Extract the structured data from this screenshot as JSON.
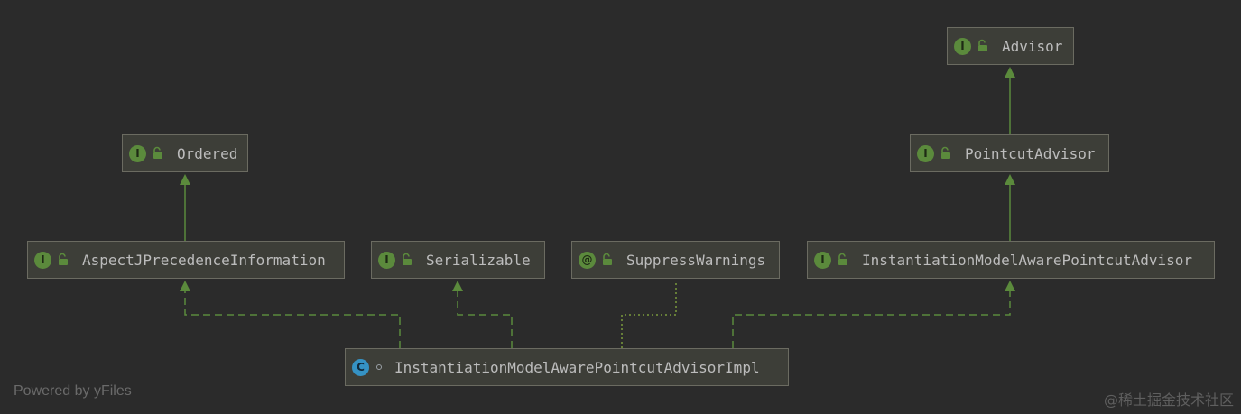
{
  "colors": {
    "background": "#2b2b2b",
    "node_fill": "#3d3e38",
    "node_border": "#6b6b61",
    "edge_green": "#5b8a3c",
    "interface_badge": "#5b8a3c",
    "class_badge": "#3592c4"
  },
  "nodes": {
    "advisor": {
      "badge": "I",
      "label": "Advisor"
    },
    "ordered": {
      "badge": "I",
      "label": "Ordered"
    },
    "pointcut_advisor": {
      "badge": "I",
      "label": "PointcutAdvisor"
    },
    "aspectj_precedence": {
      "badge": "I",
      "label": "AspectJPrecedenceInformation"
    },
    "serializable": {
      "badge": "I",
      "label": "Serializable"
    },
    "suppress_warnings": {
      "badge": "@",
      "label": "SuppressWarnings"
    },
    "instantiation_model_aware": {
      "badge": "I",
      "label": "InstantiationModelAwarePointcutAdvisor"
    },
    "impl": {
      "badge": "C",
      "label": "InstantiationModelAwarePointcutAdvisorImpl"
    }
  },
  "icons": {
    "interface": "interface-icon",
    "annotation": "annotation-icon",
    "class": "class-icon",
    "visibility": "lock-open-icon"
  },
  "footer": {
    "powered_by": "Powered by yFiles",
    "watermark": "@稀土掘金技术社区"
  }
}
